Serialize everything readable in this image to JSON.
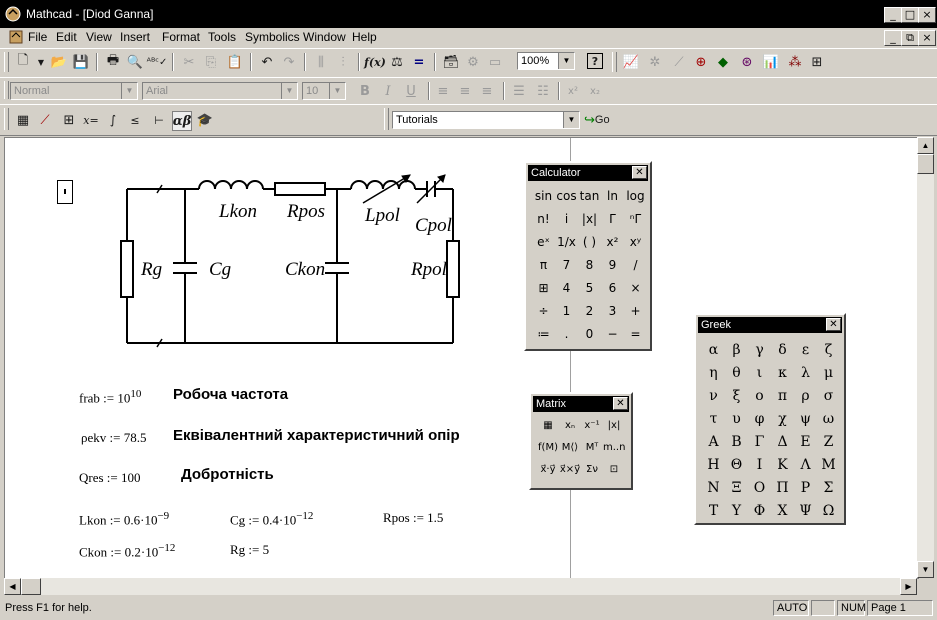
{
  "window": {
    "title": "Mathcad - [Diod Ganna]",
    "controls": [
      "_",
      "□",
      "×"
    ],
    "inner_controls": [
      "_",
      "⧉",
      "×"
    ]
  },
  "menu": [
    "File",
    "Edit",
    "View",
    "Insert",
    "Format",
    "Tools",
    "Symbolics",
    "Window",
    "Help"
  ],
  "toolbar": {
    "zoom": "100%",
    "style": "Normal",
    "font": "Arial",
    "size": "10",
    "tutorials": "Tutorials",
    "go": "Go"
  },
  "document": {
    "circuit_labels": {
      "lkon": "Lkon",
      "rpos": "Rpos",
      "lpol": "Lpol",
      "cpol": "Cpol",
      "rg": "Rg",
      "cg": "Cg",
      "ckon": "Ckon",
      "rpol": "Rpol"
    },
    "equations": {
      "frab": "frab := 10",
      "frab_exp": "10",
      "pekv": "ρekv := 78.5",
      "qres": "Qres := 100",
      "lkon": "Lkon := 0.6·10",
      "lkon_exp": "−9",
      "cg": "Cg := 0.4·10",
      "cg_exp": "−12",
      "rpos": "Rpos := 1.5",
      "ckon": "Ckon := 0.2·10",
      "ckon_exp": "−12",
      "rg": "Rg := 5"
    },
    "notes": {
      "frab": "Робоча частота",
      "pekv": "Еквівалентний характеристичний опір",
      "qres": "Добротність"
    }
  },
  "palettes": {
    "calculator": {
      "title": "Calculator",
      "keys": [
        "sin",
        "cos",
        "tan",
        "ln",
        "log",
        "n!",
        "i",
        "|x|",
        "Γ",
        "ⁿΓ",
        "eˣ",
        "1/x",
        "( )",
        "x²",
        "xʸ",
        "π",
        "7",
        "8",
        "9",
        "/",
        "⊞",
        "4",
        "5",
        "6",
        "×",
        "÷",
        "1",
        "2",
        "3",
        "+",
        "≔",
        ".",
        "0",
        "−",
        "="
      ]
    },
    "matrix": {
      "title": "Matrix",
      "keys": [
        "▦",
        "xₙ",
        "x⁻¹",
        "|x|",
        "f(M)",
        "M⟨⟩",
        "Mᵀ",
        "m..n",
        "x⃗·y⃗",
        "x⃗×y⃗",
        "Σν",
        "⊡"
      ]
    },
    "greek": {
      "title": "Greek",
      "keys": [
        "α",
        "β",
        "γ",
        "δ",
        "ε",
        "ζ",
        "η",
        "θ",
        "ι",
        "κ",
        "λ",
        "μ",
        "ν",
        "ξ",
        "ο",
        "π",
        "ρ",
        "σ",
        "τ",
        "υ",
        "φ",
        "χ",
        "ψ",
        "ω",
        "Α",
        "Β",
        "Γ",
        "Δ",
        "Ε",
        "Ζ",
        "Η",
        "Θ",
        "Ι",
        "Κ",
        "Λ",
        "Μ",
        "Ν",
        "Ξ",
        "Ο",
        "Π",
        "Ρ",
        "Σ",
        "Τ",
        "Υ",
        "Φ",
        "Χ",
        "Ψ",
        "Ω"
      ]
    }
  },
  "status": {
    "help": "Press F1 for help.",
    "auto": "AUTO",
    "num": "NUM",
    "page": "Page 1"
  }
}
